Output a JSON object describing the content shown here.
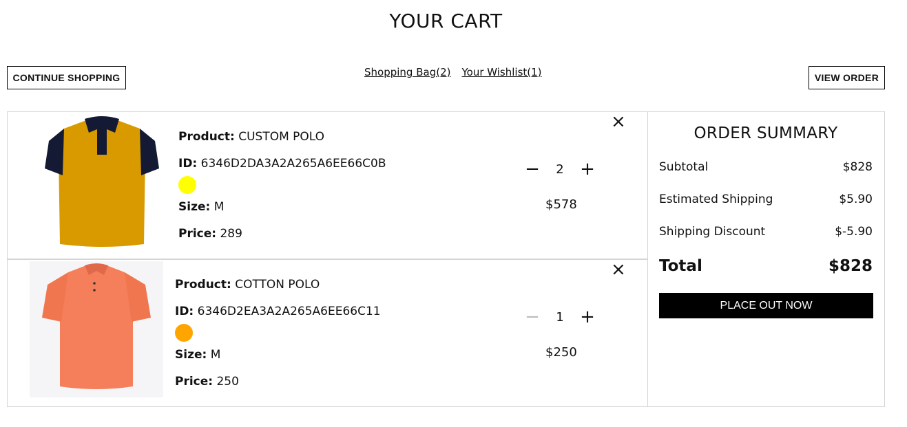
{
  "page": {
    "title": "YOUR CART"
  },
  "actions": {
    "continue_label": "CONTINUE SHOPPING",
    "view_order_label": "VIEW ORDER",
    "shopping_bag_link": "Shopping Bag(2)",
    "wishlist_link": "Your Wishlist(1)"
  },
  "labels": {
    "product": "Product:",
    "id": "ID:",
    "size": "Size:",
    "price": "Price:"
  },
  "items": [
    {
      "name": "CUSTOM POLO",
      "id": "6346D2DA3A2A265A6EE66C0B",
      "color": "#ffff00",
      "size": "M",
      "price": "289",
      "quantity": "2",
      "line_total": "$578",
      "remove_icon": "×",
      "minus_icon": "−",
      "plus_icon": "+"
    },
    {
      "name": "COTTON POLO",
      "id": "6346D2EA3A2A265A6EE66C11",
      "color": "#ffa500",
      "size": "M",
      "price": "250",
      "quantity": "1",
      "line_total": "$250",
      "remove_icon": "×",
      "minus_icon": "−",
      "plus_icon": "+"
    }
  ],
  "summary": {
    "title": "ORDER SUMMARY",
    "subtotal_label": "Subtotal",
    "subtotal_value": "$828",
    "shipping_label": "Estimated Shipping",
    "shipping_value": "$5.90",
    "discount_label": "Shipping Discount",
    "discount_value": "$-5.90",
    "total_label": "Total",
    "total_value": "$828",
    "button_label": "PLACE OUT NOW"
  },
  "colors": {
    "polo1_body": "#d99a00",
    "polo1_trim": "#141a33",
    "polo2_body": "#f47f5a"
  }
}
